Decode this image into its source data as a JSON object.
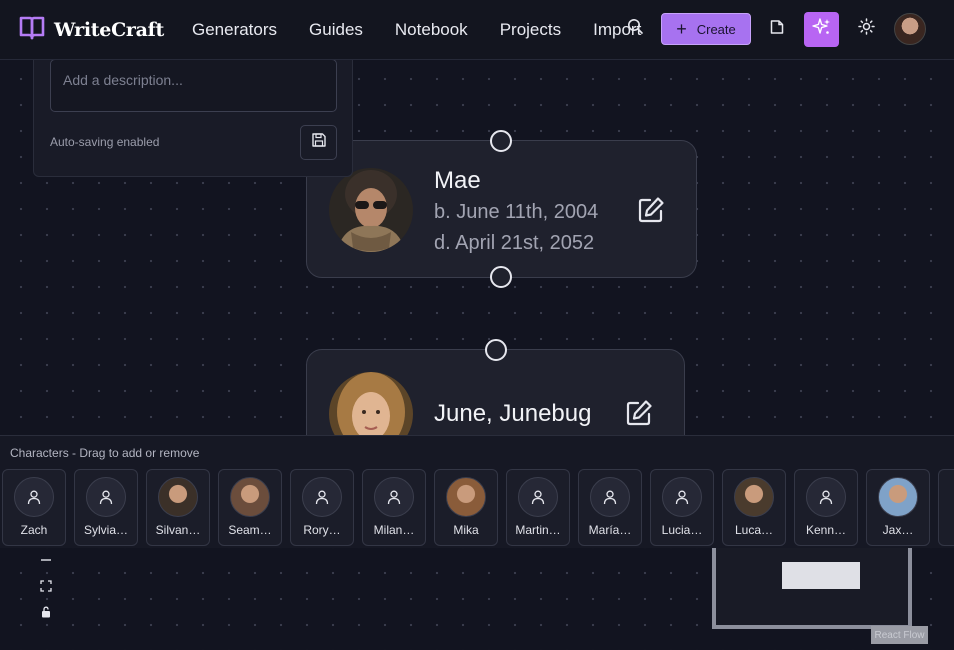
{
  "app": {
    "name": "WriteCraft"
  },
  "nav": {
    "links": [
      "Generators",
      "Guides",
      "Notebook",
      "Projects",
      "Import"
    ],
    "create_label": "Create"
  },
  "description_panel": {
    "placeholder": "Add a description...",
    "autosave_text": "Auto-saving enabled"
  },
  "nodes": [
    {
      "name": "Mae",
      "born": "b. June 11th, 2004",
      "died": "d. April 21st, 2052"
    },
    {
      "name": "June, Junebug"
    }
  ],
  "characters_bar": {
    "title": "Characters - Drag to add or remove",
    "items": [
      {
        "name": "Zach",
        "has_photo": false
      },
      {
        "name": "Sylvia…",
        "has_photo": false
      },
      {
        "name": "Silvan…",
        "has_photo": true
      },
      {
        "name": "Seam…",
        "has_photo": true
      },
      {
        "name": "Rory…",
        "has_photo": false
      },
      {
        "name": "Milan…",
        "has_photo": false
      },
      {
        "name": "Mika",
        "has_photo": true
      },
      {
        "name": "Martin…",
        "has_photo": false
      },
      {
        "name": "María…",
        "has_photo": false
      },
      {
        "name": "Lucia…",
        "has_photo": false
      },
      {
        "name": "Luca…",
        "has_photo": true
      },
      {
        "name": "Kenn…",
        "has_photo": false
      },
      {
        "name": "Jax…",
        "has_photo": true
      }
    ]
  },
  "flow": {
    "attribution": "React Flow"
  },
  "colors": {
    "accent": "#a772f0",
    "sparkle": "#b865f3",
    "background": "#121420"
  }
}
